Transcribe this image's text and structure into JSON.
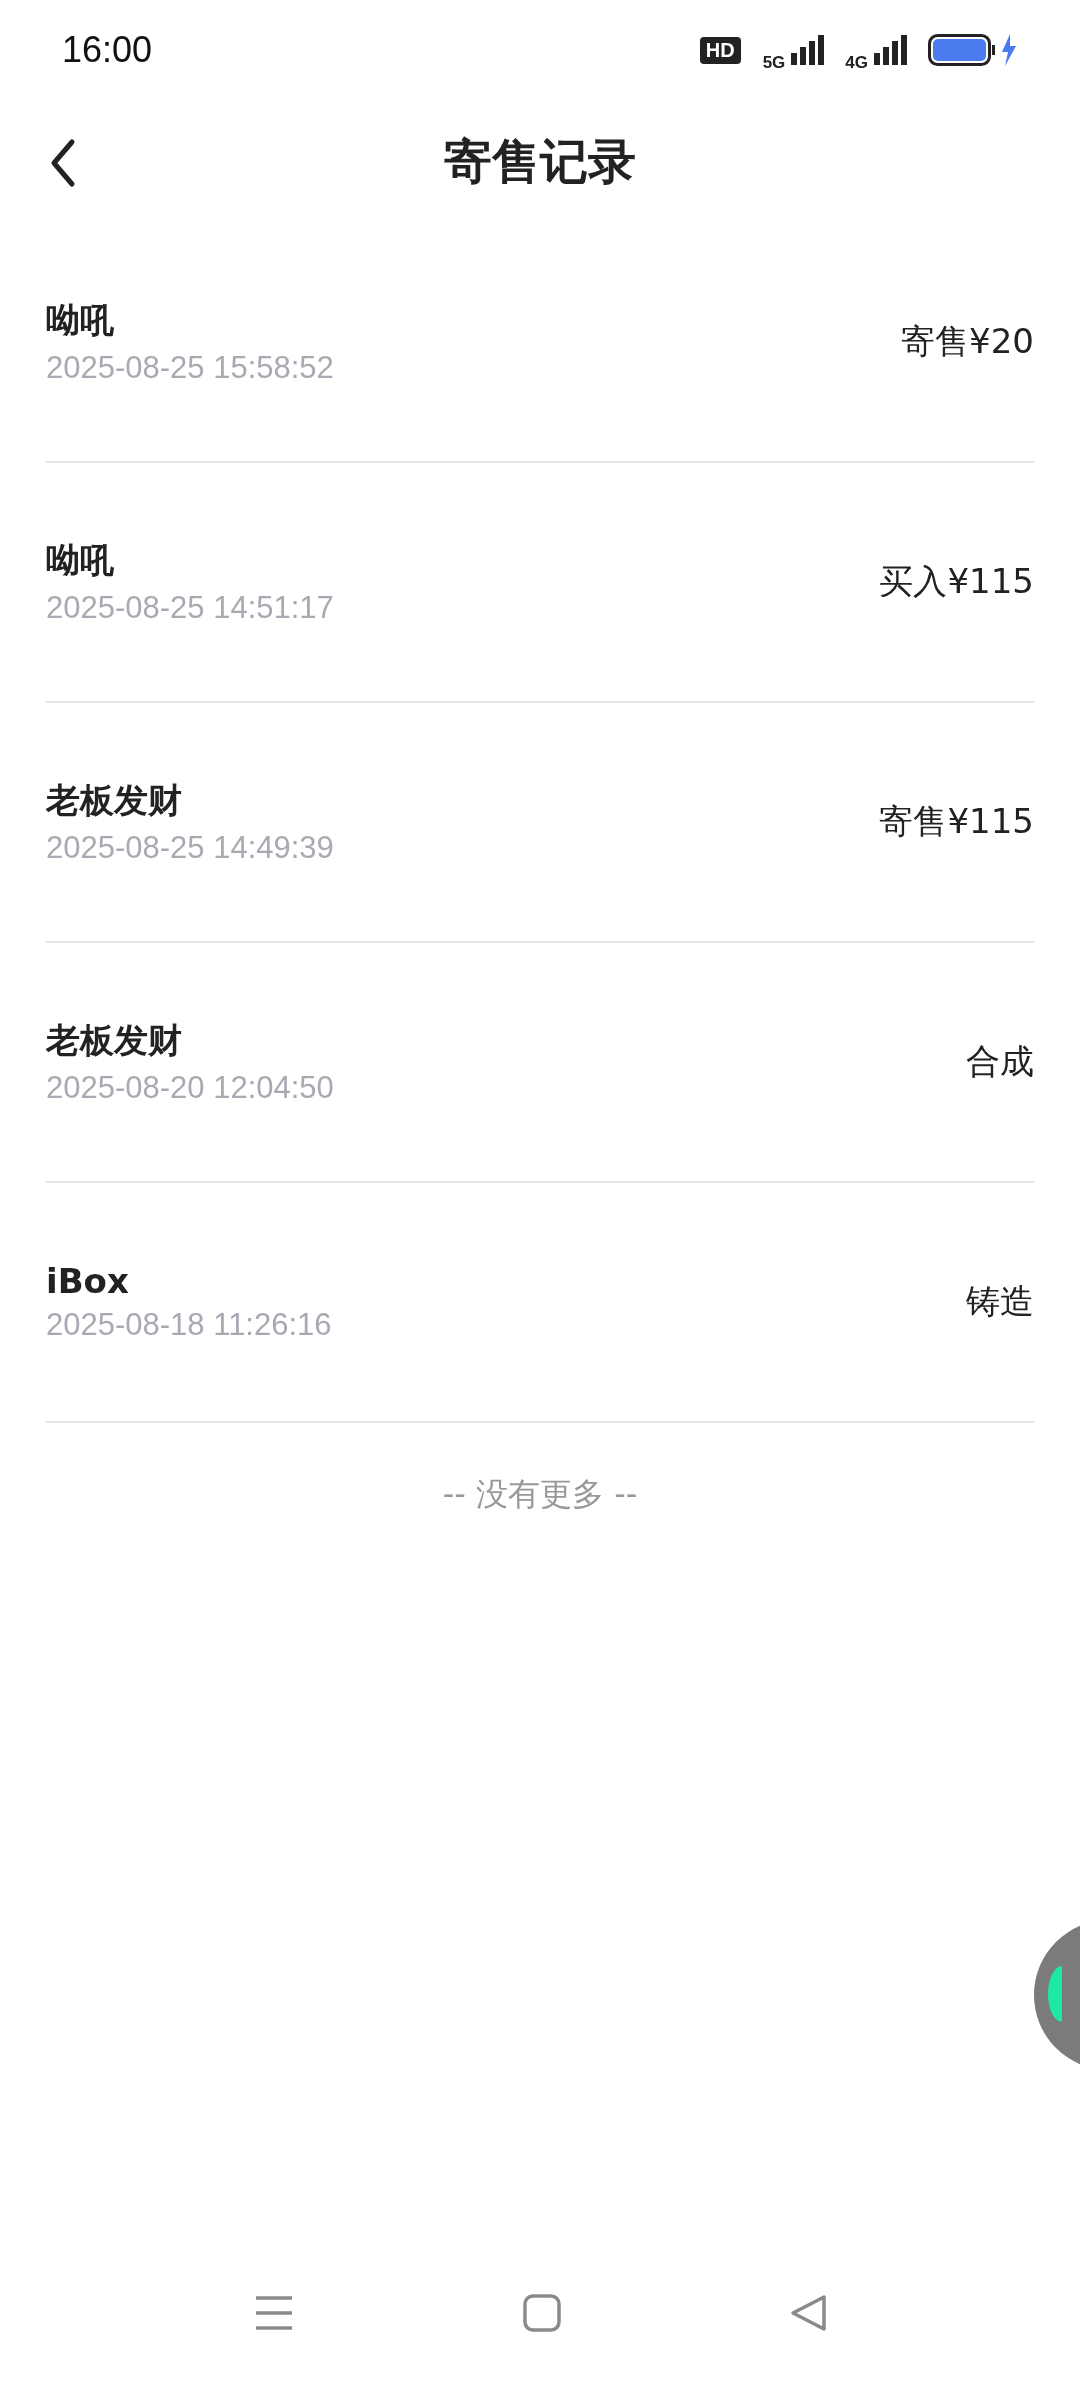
{
  "status_bar": {
    "time": "16:00",
    "hd_badge": "HD",
    "networks": [
      "5G",
      "4G"
    ]
  },
  "header": {
    "title": "寄售记录"
  },
  "records": [
    {
      "name": "呦吼",
      "time": "2025-08-25 15:58:52",
      "action": "寄售¥20"
    },
    {
      "name": "呦吼",
      "time": "2025-08-25 14:51:17",
      "action": "买入¥115"
    },
    {
      "name": "老板发财",
      "time": "2025-08-25 14:49:39",
      "action": "寄售¥115"
    },
    {
      "name": "老板发财",
      "time": "2025-08-20 12:04:50",
      "action": "合成"
    },
    {
      "name": "iBox",
      "time": "2025-08-18 11:26:16",
      "action": "铸造"
    }
  ],
  "footer": "-- 没有更多 --"
}
